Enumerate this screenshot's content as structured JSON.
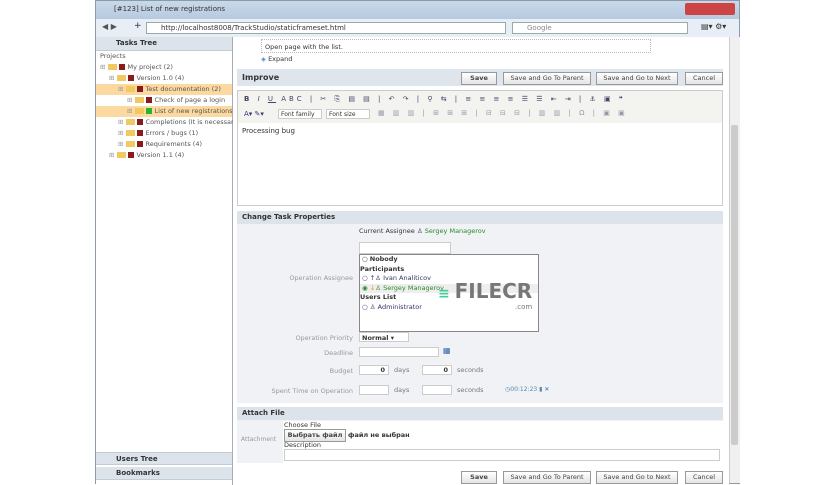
{
  "window": {
    "title": "[#123] List of new registrations",
    "url": "http://localhost8008/TrackStudio/staticframeset.html",
    "search_placeholder": "Google"
  },
  "left": {
    "tasks_tree": "Tasks Tree",
    "projects": "Projects",
    "tree": [
      {
        "label": "My project (2)",
        "indent": 0,
        "color": "#8b1a1a"
      },
      {
        "label": "Version 1.0 (4)",
        "indent": 1,
        "color": "#8b1a1a"
      },
      {
        "label": "Test documentation (2)",
        "indent": 2,
        "color": "#8b1a1a",
        "selected": true
      },
      {
        "label": "Check of page a login",
        "indent": 3,
        "color": "#8b1a1a"
      },
      {
        "label": "List of new registrations",
        "indent": 3,
        "color": "#2bb32b",
        "selected": true
      },
      {
        "label": "Completions (It is necessary",
        "indent": 2,
        "color": "#8b1a1a"
      },
      {
        "label": "Errors / bugs (1)",
        "indent": 2,
        "color": "#8b1a1a"
      },
      {
        "label": "Requirements (4)",
        "indent": 2,
        "color": "#8b1a1a"
      },
      {
        "label": "Version 1.1 (4)",
        "indent": 1,
        "color": "#8b1a1a"
      }
    ],
    "users_tree": "Users Tree",
    "bookmarks": "Bookmarks"
  },
  "main": {
    "description": "Open page with the list.",
    "expand": "Expand",
    "section_title": "Improve",
    "buttons": {
      "save": "Save",
      "save_parent": "Save and Go To Parent",
      "save_next": "Save and Go to Next",
      "cancel": "Cancel"
    },
    "editor": {
      "font_family": "Font family",
      "font_size": "Font size",
      "content": "Processing bug"
    },
    "props": {
      "title": "Change Task Properties",
      "current_assignee_label": "Current Assignee",
      "current_assignee": "Sergey Managerov",
      "operation_assignee": "Operation Assignee",
      "nobody": "Nobody",
      "participants": "Participants",
      "p1": "Ivan Analiticov",
      "p2": "Sergey Managerov",
      "users_list": "Users List",
      "u1": "Administrator",
      "priority_label": "Operation Priority",
      "priority": "Normal",
      "deadline": "Deadline",
      "budget": "Budget",
      "budget_days": "0",
      "budget_seconds": "0",
      "days": "days",
      "seconds": "seconds",
      "spent": "Spent Time on Operation",
      "timer": "00:12:23"
    },
    "attach": {
      "title": "Attach File",
      "attachment": "Attachment",
      "choose_file": "Choose File",
      "choose_button": "Выбрать файл",
      "no_file": "файл не выбран",
      "description": "Description"
    }
  },
  "watermark": {
    "text": "FILECR",
    "sub": ".com"
  }
}
